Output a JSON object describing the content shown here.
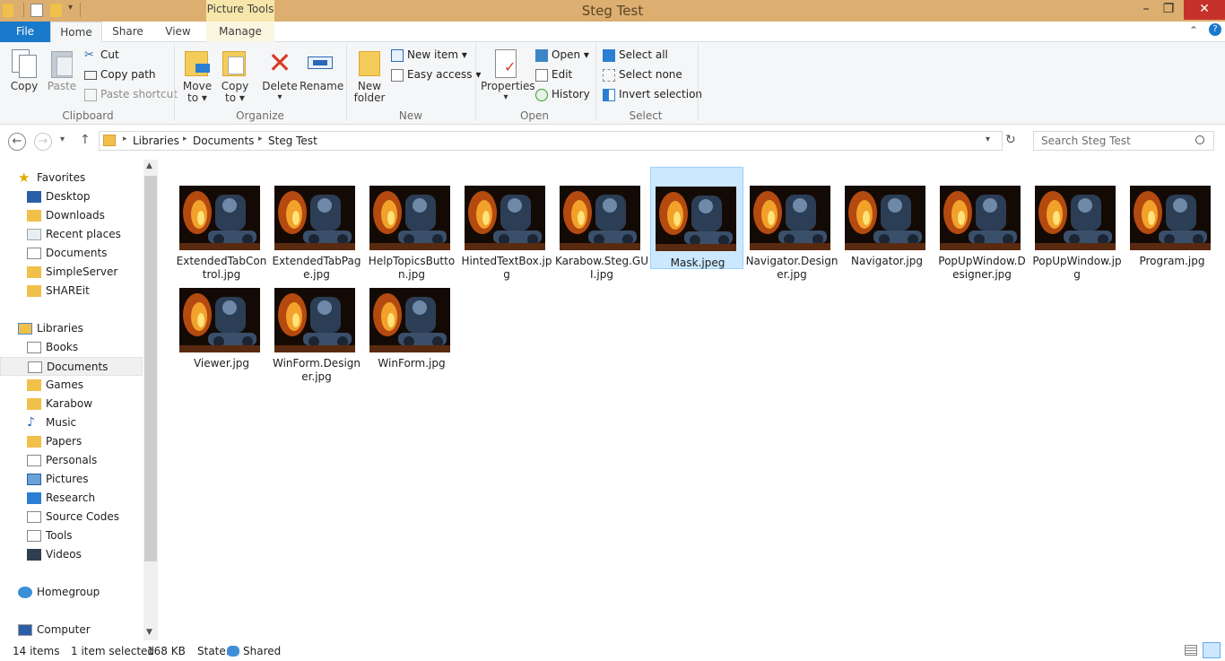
{
  "window": {
    "title": "Steg Test",
    "context_tab_group": "Picture Tools",
    "controls": {
      "minimize": "–",
      "maximize": "❐",
      "close": "✕"
    }
  },
  "ribbon_tabs": {
    "file": "File",
    "home": "Home",
    "share": "Share",
    "view": "View",
    "manage": "Manage"
  },
  "ribbon": {
    "clipboard": {
      "label": "Clipboard",
      "copy": "Copy",
      "paste": "Paste",
      "cut": "Cut",
      "copy_path": "Copy path",
      "paste_shortcut": "Paste shortcut"
    },
    "organize": {
      "label": "Organize",
      "move_to_1": "Move",
      "move_to_2": "to ▾",
      "copy_to_1": "Copy",
      "copy_to_2": "to ▾",
      "delete": "Delete",
      "delete_arrow": "▾",
      "rename": "Rename"
    },
    "new": {
      "label": "New",
      "new_folder_1": "New",
      "new_folder_2": "folder",
      "new_item": "New item ▾",
      "easy_access": "Easy access ▾"
    },
    "open": {
      "label": "Open",
      "properties": "Properties",
      "properties_arrow": "▾",
      "open": "Open ▾",
      "edit": "Edit",
      "history": "History"
    },
    "select": {
      "label": "Select",
      "select_all": "Select all",
      "select_none": "Select none",
      "invert_selection": "Invert selection"
    }
  },
  "address": {
    "breadcrumb": [
      "Libraries",
      "Documents",
      "Steg Test"
    ],
    "search_placeholder": "Search Steg Test"
  },
  "nav": {
    "favorites": {
      "label": "Favorites",
      "items": [
        "Desktop",
        "Downloads",
        "Recent places",
        "Documents",
        "SimpleServer",
        "SHAREit"
      ]
    },
    "libraries": {
      "label": "Libraries",
      "items": [
        "Books",
        "Documents",
        "Games",
        "Karabow",
        "Music",
        "Papers",
        "Personals",
        "Pictures",
        "Research",
        "Source Codes",
        "Tools",
        "Videos"
      ]
    },
    "homegroup": "Homegroup",
    "computer": "Computer"
  },
  "files": [
    {
      "name": "ExtendedTabControl.jpg",
      "selected": false
    },
    {
      "name": "ExtendedTabPage.jpg",
      "selected": false
    },
    {
      "name": "HelpTopicsButton.jpg",
      "selected": false
    },
    {
      "name": "HintedTextBox.jpg",
      "selected": false
    },
    {
      "name": "Karabow.Steg.GUI.jpg",
      "selected": false
    },
    {
      "name": "Mask.jpeg",
      "selected": true
    },
    {
      "name": "Navigator.Designer.jpg",
      "selected": false
    },
    {
      "name": "Navigator.jpg",
      "selected": false
    },
    {
      "name": "PopUpWindow.Designer.jpg",
      "selected": false
    },
    {
      "name": "PopUpWindow.jpg",
      "selected": false
    },
    {
      "name": "Program.jpg",
      "selected": false
    },
    {
      "name": "Viewer.jpg",
      "selected": false
    },
    {
      "name": "WinForm.Designer.jpg",
      "selected": false
    },
    {
      "name": "WinForm.jpg",
      "selected": false
    }
  ],
  "status": {
    "items": "14 items",
    "selected": "1 item selected",
    "size": "168 KB",
    "state_label": "State:",
    "state_value": "Shared"
  },
  "colors": {
    "titlebar": "#dcae70",
    "file_tab": "#1979ca",
    "selection": "#cce8ff",
    "close": "#c7312b"
  }
}
